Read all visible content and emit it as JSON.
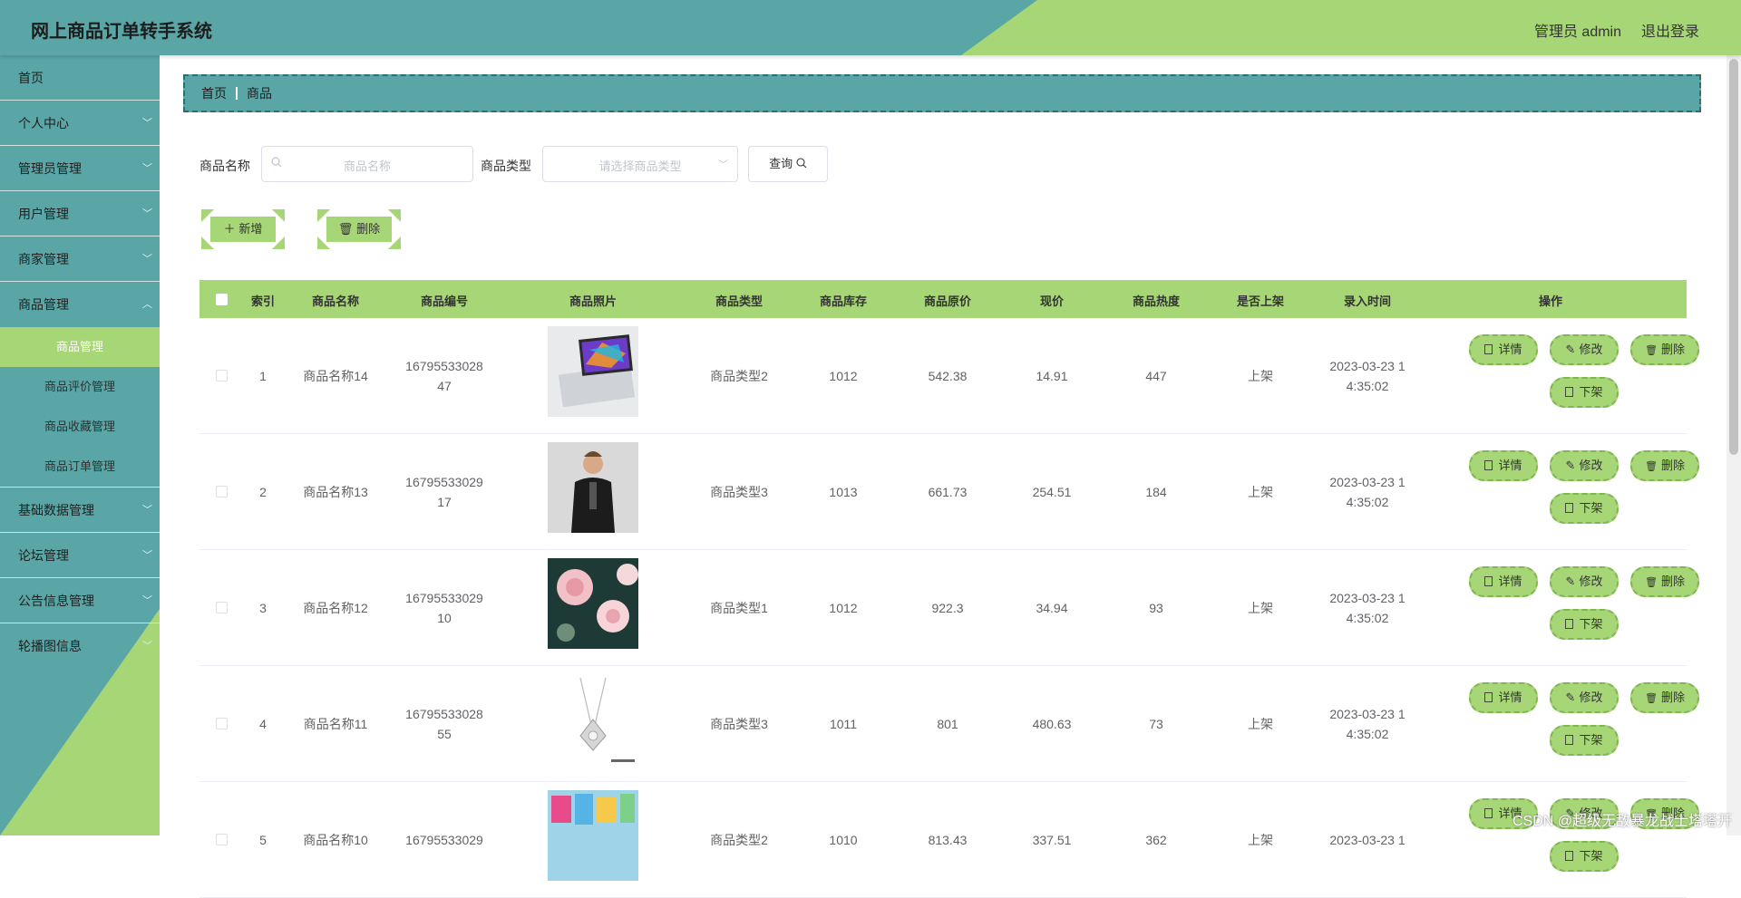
{
  "header": {
    "title": "网上商品订单转手系统",
    "admin": "管理员 admin",
    "logout": "退出登录"
  },
  "sidebar": {
    "items": [
      {
        "label": "首页"
      },
      {
        "label": "个人中心"
      },
      {
        "label": "管理员管理"
      },
      {
        "label": "用户管理"
      },
      {
        "label": "商家管理"
      },
      {
        "label": "商品管理"
      }
    ],
    "subitems": [
      {
        "label": "商品管理"
      },
      {
        "label": "商品评价管理"
      },
      {
        "label": "商品收藏管理"
      },
      {
        "label": "商品订单管理"
      }
    ],
    "items_after": [
      {
        "label": "基础数据管理"
      },
      {
        "label": "论坛管理"
      },
      {
        "label": "公告信息管理"
      },
      {
        "label": "轮播图信息"
      }
    ]
  },
  "breadcrumb": {
    "home": "首页",
    "current": "商品"
  },
  "search": {
    "name_label": "商品名称",
    "name_placeholder": "商品名称",
    "type_label": "商品类型",
    "type_placeholder": "请选择商品类型",
    "query_label": "查询"
  },
  "actions": {
    "add": "新增",
    "delete": "删除"
  },
  "table": {
    "headers": [
      "索引",
      "商品名称",
      "商品编号",
      "商品照片",
      "商品类型",
      "商品库存",
      "商品原价",
      "现价",
      "商品热度",
      "是否上架",
      "录入时间",
      "操作"
    ],
    "ops": {
      "detail": "详情",
      "edit": "修改",
      "delete": "删除",
      "offshelf": "下架"
    },
    "rows": [
      {
        "index": "1",
        "name": "商品名称14",
        "code1": "16795533028",
        "code2": "47",
        "type": "商品类型2",
        "stock": "1012",
        "orig": "542.38",
        "price": "14.91",
        "heat": "447",
        "onshelf": "上架",
        "time1": "2023-03-23 1",
        "time2": "4:35:02",
        "img": "laptop"
      },
      {
        "index": "2",
        "name": "商品名称13",
        "code1": "16795533029",
        "code2": "17",
        "type": "商品类型3",
        "stock": "1013",
        "orig": "661.73",
        "price": "254.51",
        "heat": "184",
        "onshelf": "上架",
        "time1": "2023-03-23 1",
        "time2": "4:35:02",
        "img": "man"
      },
      {
        "index": "3",
        "name": "商品名称12",
        "code1": "16795533029",
        "code2": "10",
        "type": "商品类型1",
        "stock": "1012",
        "orig": "922.3",
        "price": "34.94",
        "heat": "93",
        "onshelf": "上架",
        "time1": "2023-03-23 1",
        "time2": "4:35:02",
        "img": "roses"
      },
      {
        "index": "4",
        "name": "商品名称11",
        "code1": "16795533028",
        "code2": "55",
        "type": "商品类型3",
        "stock": "1011",
        "orig": "801",
        "price": "480.63",
        "heat": "73",
        "onshelf": "上架",
        "time1": "2023-03-23 1",
        "time2": "4:35:02",
        "img": "necklace"
      },
      {
        "index": "5",
        "name": "商品名称10",
        "code1": "16795533029",
        "code2": "",
        "type": "商品类型2",
        "stock": "1010",
        "orig": "813.43",
        "price": "337.51",
        "heat": "362",
        "onshelf": "上架",
        "time1": "2023-03-23 1",
        "time2": "",
        "img": "colors"
      }
    ]
  },
  "watermark": "CSDN @超级无敌暴龙战士塔塔开"
}
